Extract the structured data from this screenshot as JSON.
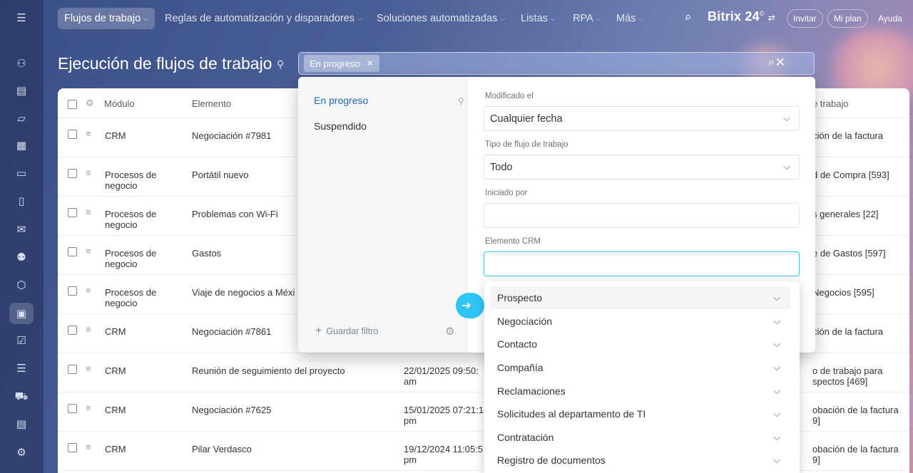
{
  "nav": {
    "items": [
      {
        "label": "Flujos de trabajo",
        "active": true
      },
      {
        "label": "Reglas de automatización y disparadores"
      },
      {
        "label": "Soluciones automatizadas"
      },
      {
        "label": "Listas"
      },
      {
        "label": "RPA"
      },
      {
        "label": "Más"
      }
    ],
    "brand": "Bitrix 24",
    "brand_mark": "©",
    "invite": "Invitar",
    "plan": "Mi plan",
    "help": "Ayuda"
  },
  "page": {
    "title": "Ejecución de flujos de trabajo"
  },
  "filter": {
    "chip": "En progreso",
    "presets": [
      "En progreso",
      "Suspendido"
    ],
    "save_label": "Guardar filtro",
    "fields": {
      "modified_label": "Modificado el",
      "modified_value": "Cualquier fecha",
      "type_label": "Tipo de flujo de trabajo",
      "type_value": "Todo",
      "started_label": "Iniciado por",
      "started_value": "",
      "crm_label": "Elemento CRM",
      "crm_value": ""
    },
    "crm_options": [
      "Prospecto",
      "Negociación",
      "Contacto",
      "Compañía",
      "Reclamaciones",
      "Solicitudes al departamento de TI",
      "Contratación",
      "Registro de documentos"
    ]
  },
  "table": {
    "headers": {
      "module": "Módulo",
      "element": "Elemento",
      "template": "e trabajo"
    },
    "rows": [
      {
        "module": "CRM",
        "element": "Negociación #7981",
        "date": "",
        "template": "ción de la factura"
      },
      {
        "module": "Procesos de negocio",
        "element": "Portátil nuevo",
        "date": "",
        "template": "d de Compra [593]"
      },
      {
        "module": "Procesos de negocio",
        "element": "Problemas con Wi-Fi",
        "date": "",
        "template": "s generales [22]"
      },
      {
        "module": "Procesos de negocio",
        "element": "Gastos",
        "date": "",
        "template": "e de Gastos [597]"
      },
      {
        "module": "Procesos de negocio",
        "element": "Viaje de negocios a Méxi",
        "date": "",
        "template": "Negocios [595]"
      },
      {
        "module": "CRM",
        "element": "Negociación #7861",
        "date": "",
        "template": "ción de la factura"
      },
      {
        "module": "CRM",
        "element": "Reunión de seguimiento del proyecto",
        "date": "22/01/2025 09:50:",
        "date2": "am",
        "template": "o de trabajo para",
        "template2": "spectos [469]"
      },
      {
        "module": "CRM",
        "element": "Negociación #7625",
        "date": "15/01/2025 07:21:1",
        "date2": "pm",
        "template": "obación de la factura",
        "template2": "9]"
      },
      {
        "module": "CRM",
        "element": "Pilar Verdasco",
        "date": "19/12/2024 11:05:5",
        "date2": "pm",
        "template": "obación de la factura",
        "template2": "9]"
      }
    ]
  }
}
